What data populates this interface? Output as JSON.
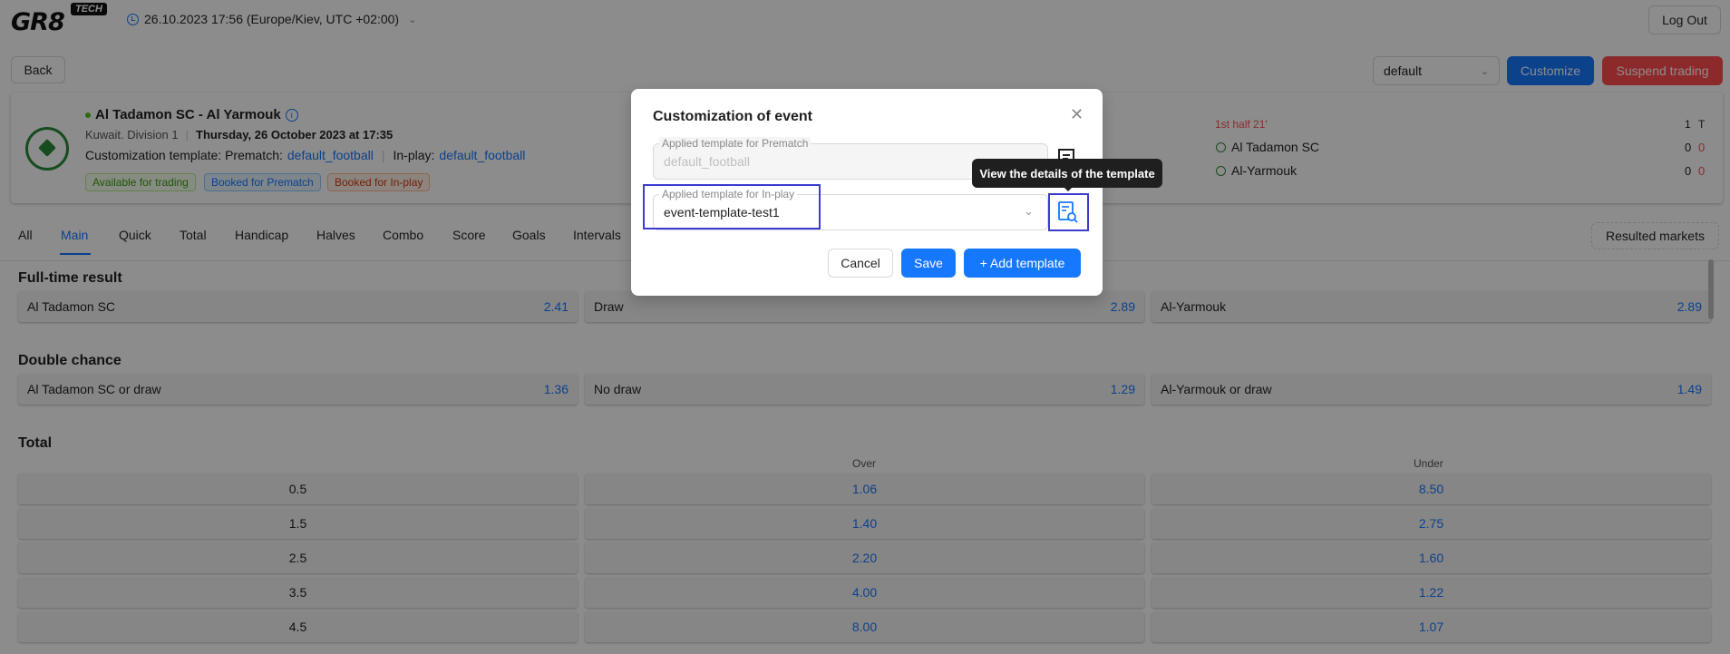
{
  "header": {
    "logo_text": "GR8",
    "logo_badge": "TECH",
    "datetime": "26.10.2023 17:56 (Europe/Kiev, UTC +02:00)",
    "logout_label": "Log Out"
  },
  "toolbar": {
    "back_label": "Back",
    "profile_select": "default",
    "customize_label": "Customize",
    "suspend_label": "Suspend trading"
  },
  "event": {
    "title": "Al Tadamon SC - Al Yarmouk",
    "league": "Kuwait. Division 1",
    "date": "Thursday, 26 October 2023 at 17:35",
    "template_prefix": "Customization template: Prematch:",
    "prematch_template": "default_football",
    "inplay_prefix": "In-play:",
    "inplay_template": "default_football",
    "tags": [
      "Available for trading",
      "Booked for Prematch",
      "Booked for In-play"
    ],
    "period": "1st half 21'",
    "score_header": [
      "1",
      "T"
    ],
    "teams": [
      {
        "name": "Al Tadamon SC",
        "score1": "0",
        "scoreT": "0"
      },
      {
        "name": "Al-Yarmouk",
        "score1": "0",
        "scoreT": "0"
      }
    ]
  },
  "tabs": [
    "All",
    "Main",
    "Quick",
    "Total",
    "Handicap",
    "Halves",
    "Combo",
    "Score",
    "Goals",
    "Intervals"
  ],
  "resulted_markets_label": "Resulted markets",
  "markets": {
    "full_time": {
      "title": "Full-time result",
      "outcomes": [
        {
          "name": "Al Tadamon SC",
          "odd": "2.41"
        },
        {
          "name": "Draw",
          "odd": "2.89"
        },
        {
          "name": "Al-Yarmouk",
          "odd": "2.89"
        }
      ]
    },
    "double_chance": {
      "title": "Double chance",
      "outcomes": [
        {
          "name": "Al Tadamon SC or draw",
          "odd": "1.36"
        },
        {
          "name": "No draw",
          "odd": "1.29"
        },
        {
          "name": "Al-Yarmouk or draw",
          "odd": "1.49"
        }
      ]
    },
    "total": {
      "title": "Total",
      "over_label": "Over",
      "under_label": "Under",
      "rows": [
        {
          "line": "0.5",
          "over": "1.06",
          "under": "8.50"
        },
        {
          "line": "1.5",
          "over": "1.40",
          "under": "2.75"
        },
        {
          "line": "2.5",
          "over": "2.20",
          "under": "1.60"
        },
        {
          "line": "3.5",
          "over": "4.00",
          "under": "1.22"
        },
        {
          "line": "4.5",
          "over": "8.00",
          "under": "1.07"
        }
      ]
    }
  },
  "modal": {
    "title": "Customization of event",
    "prematch_label": "Applied template for Prematch",
    "prematch_value": "default_football",
    "inplay_label": "Applied template for In-play",
    "inplay_value": "event-template-test1",
    "tooltip": "View the details of the template",
    "cancel_label": "Cancel",
    "save_label": "Save",
    "add_template_label": "+ Add template"
  },
  "colors": {
    "primary": "#1677ff",
    "danger": "#ff4d4f",
    "highlight": "#3b3bcf",
    "live_green": "#52c41a"
  }
}
